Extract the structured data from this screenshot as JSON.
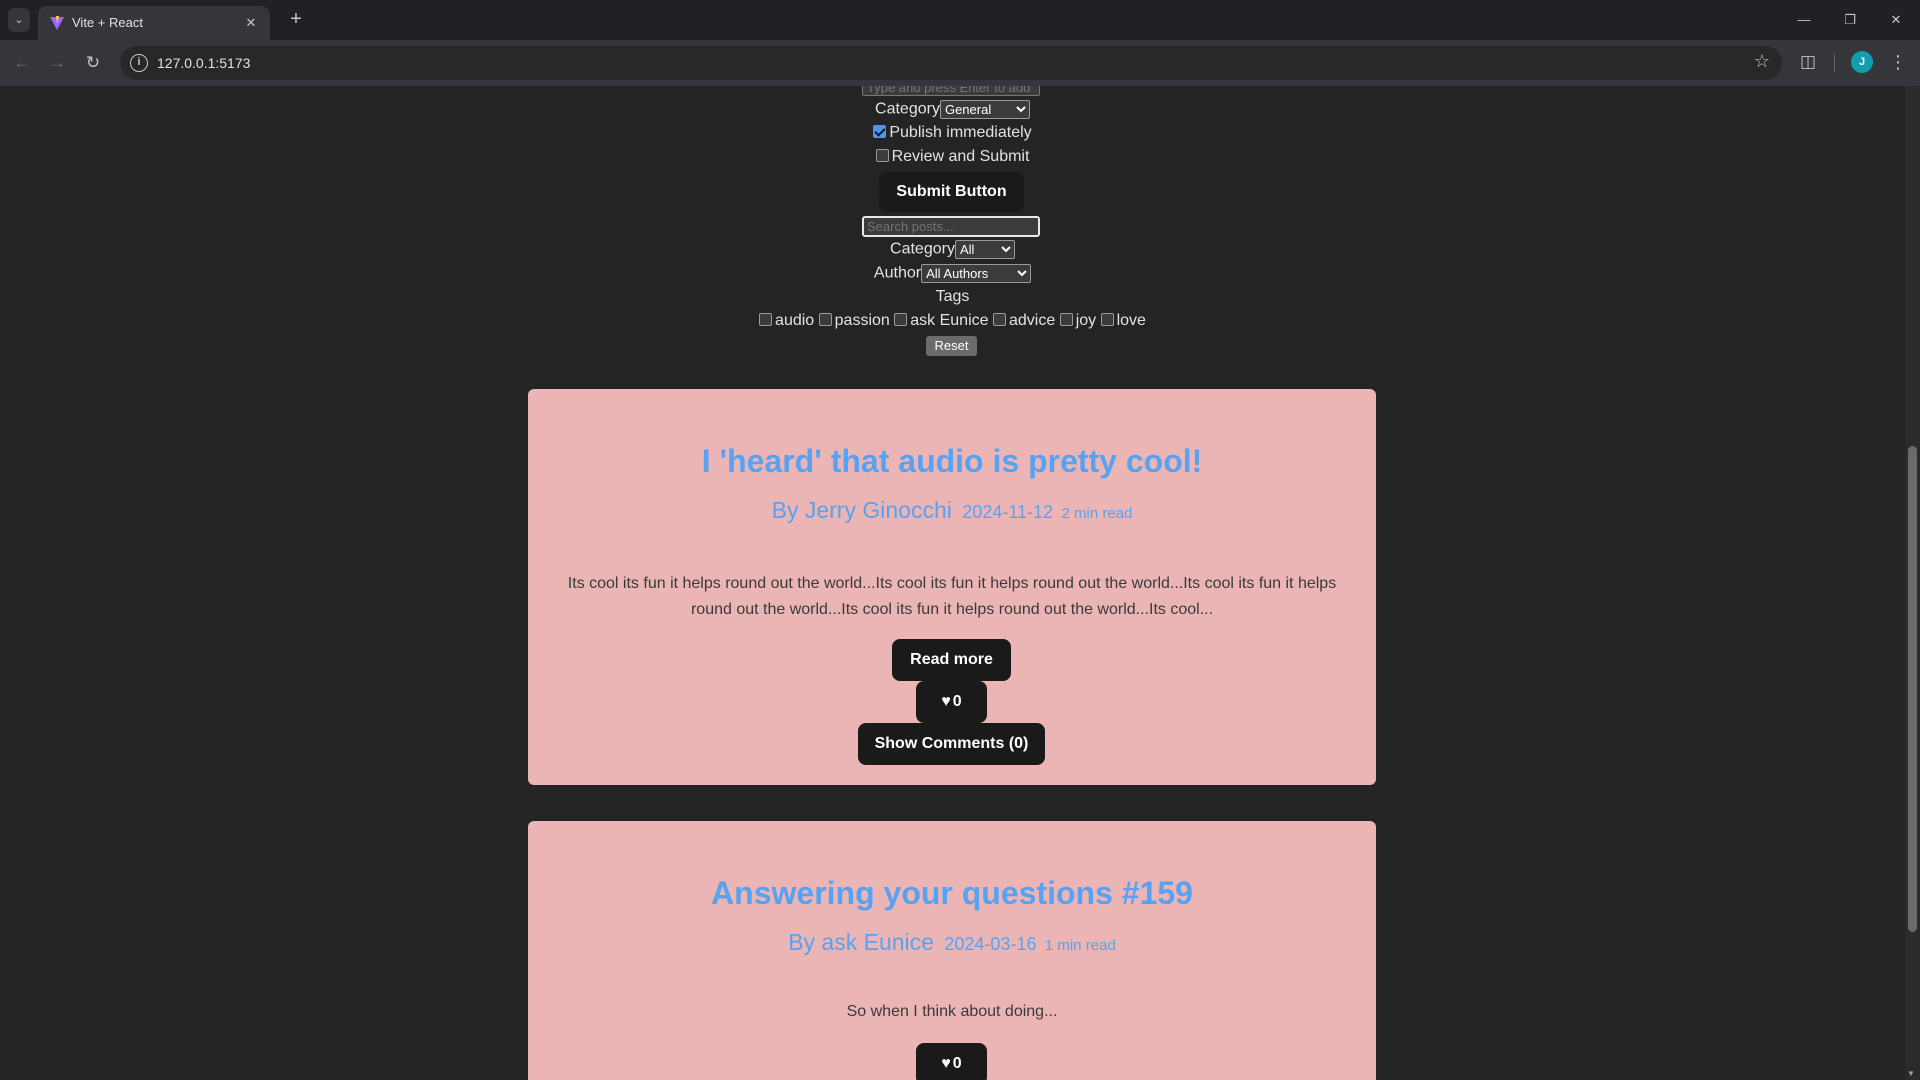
{
  "browser": {
    "tab_title": "Vite + React",
    "url": "127.0.0.1:5173",
    "new_tab_symbol": "+",
    "avatar_letter": "J"
  },
  "form": {
    "tag_input_placeholder": "Type and press Enter to add",
    "category_label": "Category",
    "category_value": "General",
    "publish_label": "Publish immediately",
    "publish_checked": true,
    "review_label": "Review and Submit",
    "review_checked": false,
    "submit_label": "Submit Button"
  },
  "filters": {
    "search_placeholder": "Search posts...",
    "category_label": "Category",
    "category_value": "All",
    "author_label": "Author",
    "author_value": "All Authors",
    "tags_label": "Tags",
    "tags": [
      "audio",
      "passion",
      "ask Eunice",
      "advice",
      "joy",
      "love"
    ],
    "reset_label": "Reset"
  },
  "posts": [
    {
      "title": "I 'heard' that audio is pretty cool!",
      "author": "By Jerry Ginocchi",
      "date": "2024-11-12",
      "read_time": "2 min read",
      "excerpt": "Its cool its fun it helps round out the world...Its cool its fun it helps round out the world...Its cool its fun it helps round out the world...Its cool its fun it helps round out the world...Its cool...",
      "read_more_label": "Read more",
      "likes": "0",
      "comments_label": "Show Comments (0)"
    },
    {
      "title": "Answering your questions #159",
      "author": "By ask Eunice",
      "date": "2024-03-16",
      "read_time": "1 min read",
      "excerpt": "So when I think about doing...",
      "likes": "0"
    }
  ]
}
